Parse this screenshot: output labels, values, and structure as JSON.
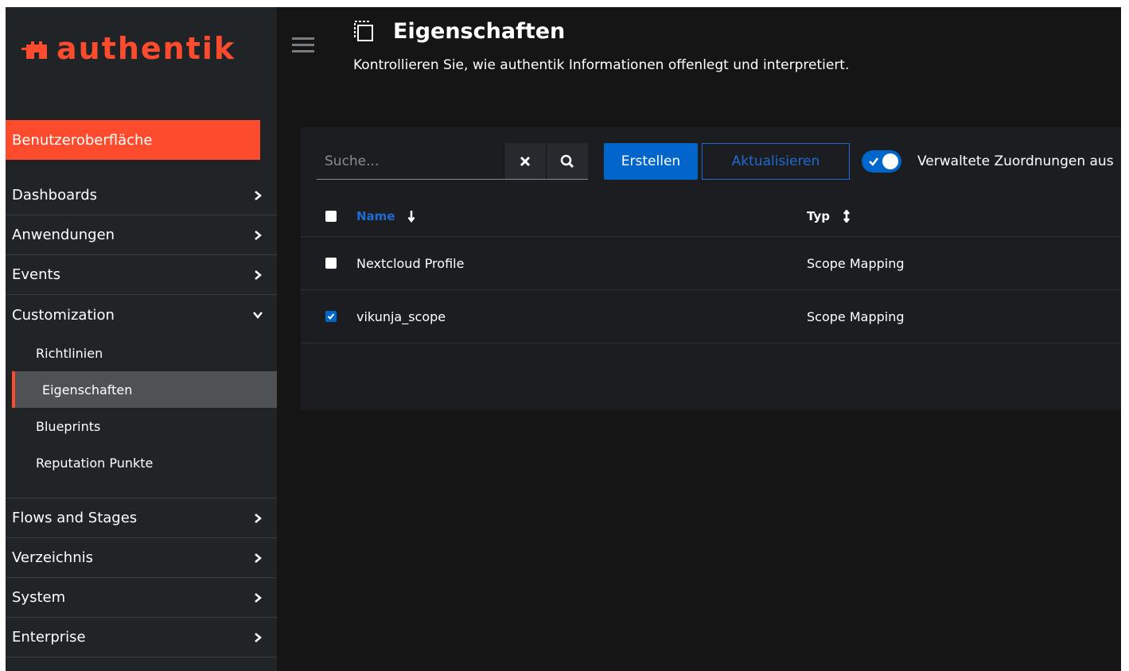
{
  "brand": {
    "name": "authentik",
    "accent": "#fd4b2d"
  },
  "sidebar": {
    "section_header": "Benutzeroberfläche",
    "items": [
      {
        "label": "Dashboards",
        "expanded": false
      },
      {
        "label": "Anwendungen",
        "expanded": false
      },
      {
        "label": "Events",
        "expanded": false
      },
      {
        "label": "Customization",
        "expanded": true,
        "children": [
          "Richtlinien",
          "Eigenschaften",
          "Blueprints",
          "Reputation Punkte"
        ],
        "active_child": "Eigenschaften"
      },
      {
        "label": "Flows and Stages",
        "expanded": false
      },
      {
        "label": "Verzeichnis",
        "expanded": false
      },
      {
        "label": "System",
        "expanded": false
      },
      {
        "label": "Enterprise",
        "expanded": false
      }
    ]
  },
  "header": {
    "title": "Eigenschaften",
    "description": "Kontrollieren Sie, wie authentik Informationen offenlegt und interpretiert.",
    "title_icon": "property-mapping-icon"
  },
  "toolbar": {
    "search_placeholder": "Suche...",
    "clear_icon": "close-icon",
    "search_icon": "search-icon",
    "create_label": "Erstellen",
    "refresh_label": "Aktualisieren",
    "toggle_label": "Verwaltete Zuordnungen aus",
    "toggle_on": true
  },
  "table": {
    "columns": [
      "Name",
      "Typ"
    ],
    "rows": [
      {
        "name": "Nextcloud Profile",
        "type": "Scope Mapping",
        "checked": false
      },
      {
        "name": "vikunja_scope",
        "type": "Scope Mapping",
        "checked": true
      }
    ]
  },
  "colors": {
    "primary": "#0066cc",
    "link": "#1f6ad3",
    "sidebar_bg": "#212427",
    "page_bg": "#151515"
  }
}
